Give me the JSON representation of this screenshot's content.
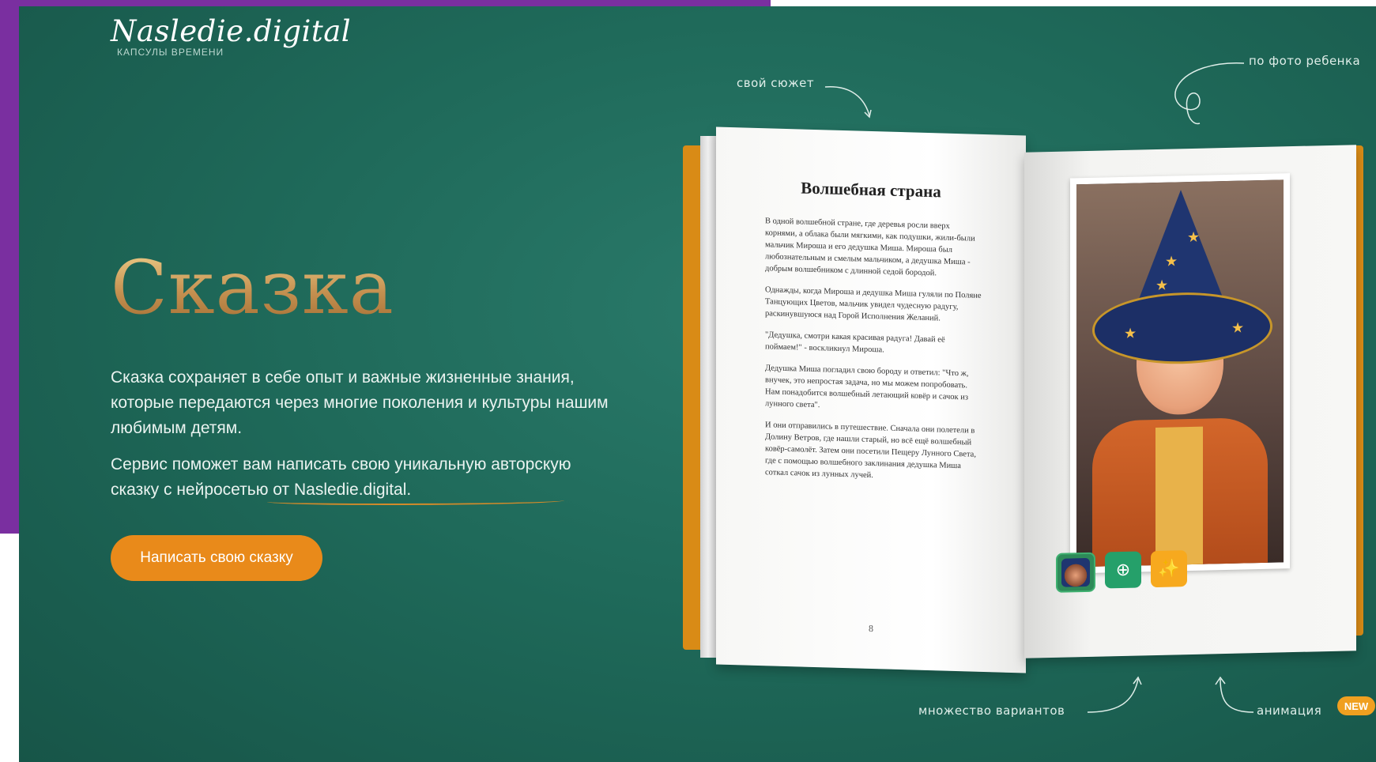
{
  "logo": {
    "name": "Nasledie.digital",
    "subtitle": "КАПСУЛЫ ВРЕМЕНИ"
  },
  "hero": {
    "title": "Сказка",
    "description": "Сказка сохраняет в себе опыт и важные жизненные знания, которые передаются через многие поколения и культуры нашим любимым детям.",
    "description2": "Сервис поможет вам написать свою уникальную авторскую сказку с нейросетью от Nasledie.digital.",
    "cta_label": "Написать свою сказку"
  },
  "annotations": {
    "plot": "свой сюжет",
    "photo": "по фото ребенка",
    "variants": "множество вариантов",
    "animation": "анимация",
    "new_badge": "NEW"
  },
  "book": {
    "story_title": "Волшебная страна",
    "paragraphs": [
      "В одной волшебной стране, где деревья росли вверх корнями, а облака были мягкими, как подушки, жили-были мальчик Мироша и его дедушка Миша. Мироша был любознательным и смелым мальчиком, а дедушка Миша - добрым волшебником с длинной седой бородой.",
      "Однажды, когда Мироша и дедушка Миша гуляли по Поляне Танцующих Цветов, мальчик увидел чудесную радугу, раскинувшуюся над Горой Исполнения Желаний.",
      "\"Дедушка, смотри какая красивая радуга! Давай её поймаем!\" - воскликнул Мироша.",
      "Дедушка Миша погладил свою бороду и ответил: \"Что ж, внучек, это непростая задача, но мы можем попробовать. Нам понадобится волшебный летающий ковёр и сачок из лунного света\".",
      "И они отправились в путешествие. Сначала они полетели в Долину Ветров, где нашли старый, но всё ещё волшебный ковёр-самолёт. Затем они посетили Пещеру Лунного Света, где с помощью волшебного заклинания дедушка Миша соткал сачок из лунных лучей."
    ],
    "page_number": "8",
    "thumb_icons": [
      "child-photo-thumbnail",
      "add-circle-icon",
      "magic-wand-icon"
    ]
  },
  "colors": {
    "accent": "#e98a1a",
    "background": "#1f6a5a",
    "frame": "#7a2fa0"
  }
}
